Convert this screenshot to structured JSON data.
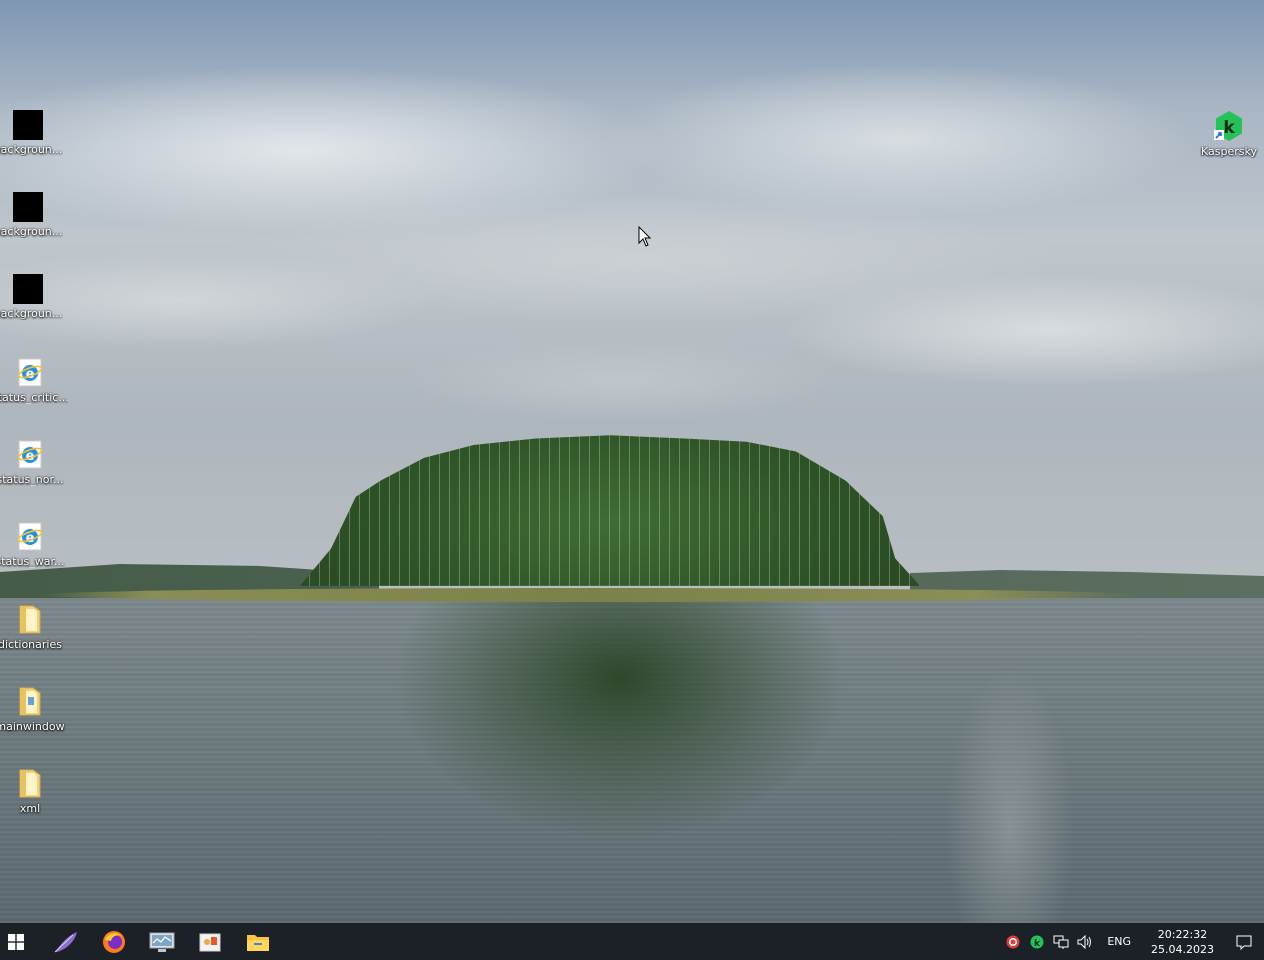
{
  "desktop": {
    "icons_left": [
      {
        "label": "backgroun...",
        "icon": "black-image-icon"
      },
      {
        "label": "backgroun...",
        "icon": "black-image-icon"
      },
      {
        "label": "backgroun...",
        "icon": "black-image-icon"
      },
      {
        "label": "status_critic...",
        "icon": "internet-explorer-icon"
      },
      {
        "label": "status_nor...",
        "icon": "internet-explorer-icon"
      },
      {
        "label": "status_war...",
        "icon": "internet-explorer-icon"
      },
      {
        "label": "dictionaries",
        "icon": "folder-icon"
      },
      {
        "label": "mainwindow",
        "icon": "folder-icon"
      },
      {
        "label": "xml",
        "icon": "folder-icon"
      }
    ],
    "icon_right": {
      "label": "Kaspersky",
      "icon": "kaspersky-shortcut-icon"
    }
  },
  "taskbar": {
    "apps": [
      "start-icon",
      "feather-app-icon",
      "firefox-icon",
      "system-monitor-icon",
      "office-app-icon",
      "file-explorer-icon"
    ],
    "tray": {
      "icons": [
        "record-icon",
        "kaspersky-tray-icon",
        "network-icon",
        "volume-icon"
      ],
      "language": "ENG",
      "time": "20:22:32",
      "date": "25.04.2023"
    }
  },
  "colors": {
    "taskbar": "#1c2128",
    "kaspersky_green": "#23c35a"
  }
}
